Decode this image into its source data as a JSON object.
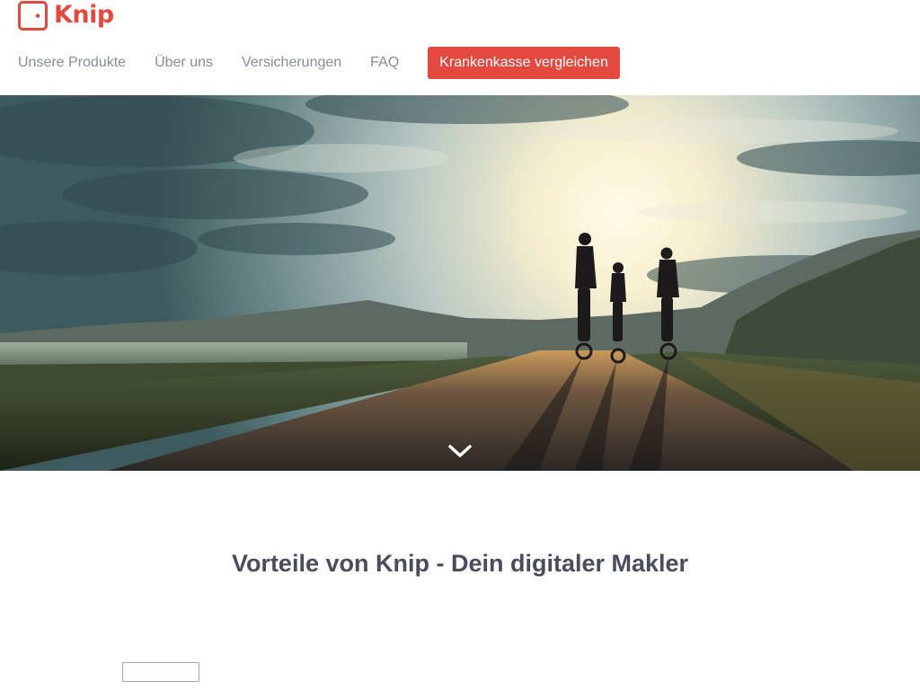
{
  "header": {
    "logo_text": "Knip",
    "brand_color": "#e3493f",
    "nav": [
      {
        "label": "Unsere Produkte"
      },
      {
        "label": "Über uns"
      },
      {
        "label": "Versicherungen"
      },
      {
        "label": "FAQ"
      }
    ],
    "cta_label": "Krankenkasse vergleichen"
  },
  "hero": {
    "image": "family-cycling-at-sunset",
    "scroll_icon": "chevron-down-icon"
  },
  "section": {
    "title": "Vorteile von Knip - Dein digitaler Makler"
  }
}
